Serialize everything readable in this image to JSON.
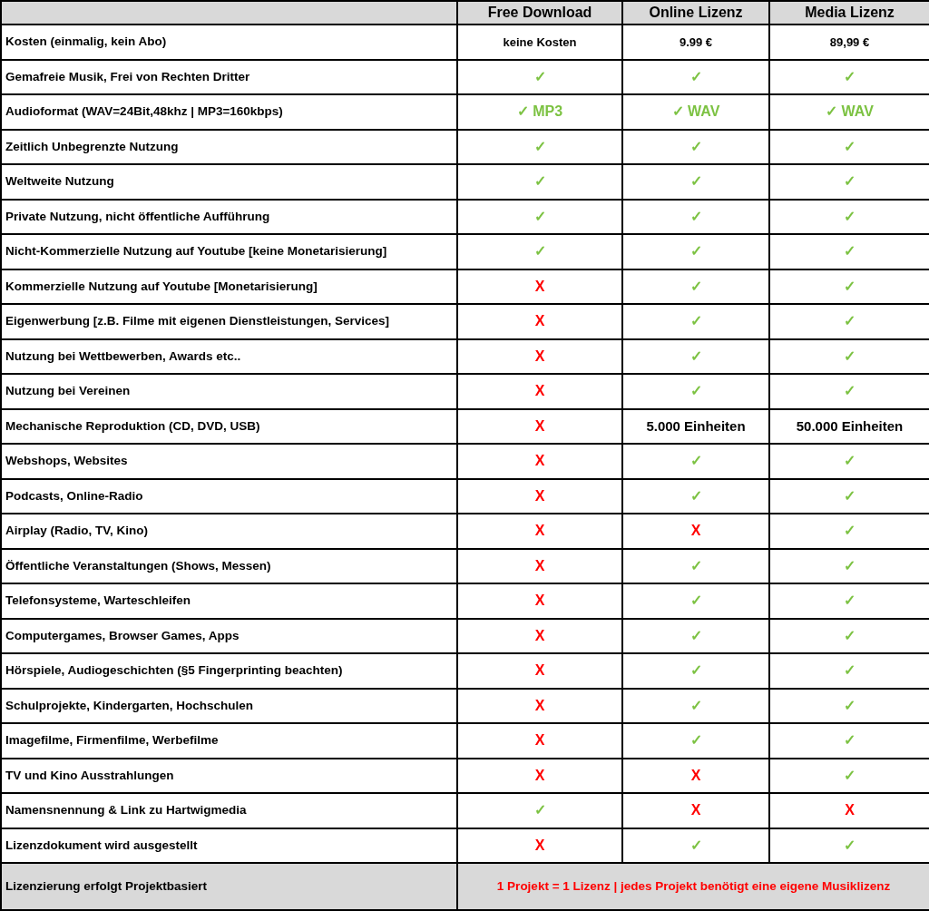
{
  "table": {
    "columns": [
      "Free Download",
      "Online Lizenz",
      "Media Lizenz"
    ],
    "rows": [
      {
        "label": "Kosten (einmalig, kein Abo)",
        "cells": [
          {
            "kind": "text",
            "text": "keine Kosten"
          },
          {
            "kind": "text",
            "text": "9.99 €"
          },
          {
            "kind": "text",
            "text": "89,99 €"
          }
        ]
      },
      {
        "label": "Gemafreie Musik, Frei von Rechten Dritter",
        "cells": [
          {
            "kind": "yes",
            "text": "✓"
          },
          {
            "kind": "yes",
            "text": "✓"
          },
          {
            "kind": "yes",
            "text": "✓"
          }
        ]
      },
      {
        "label": "Audioformat (WAV=24Bit,48khz | MP3=160kbps)",
        "cells": [
          {
            "kind": "yes",
            "text": "✓ MP3"
          },
          {
            "kind": "yes",
            "text": "✓ WAV"
          },
          {
            "kind": "yes",
            "text": "✓ WAV"
          }
        ]
      },
      {
        "label": "Zeitlich Unbegrenzte Nutzung",
        "cells": [
          {
            "kind": "yes",
            "text": "✓"
          },
          {
            "kind": "yes",
            "text": "✓"
          },
          {
            "kind": "yes",
            "text": "✓"
          }
        ]
      },
      {
        "label": "Weltweite Nutzung",
        "cells": [
          {
            "kind": "yes",
            "text": "✓"
          },
          {
            "kind": "yes",
            "text": "✓"
          },
          {
            "kind": "yes",
            "text": "✓"
          }
        ]
      },
      {
        "label": "Private Nutzung, nicht öffentliche Aufführung",
        "cells": [
          {
            "kind": "yes",
            "text": "✓"
          },
          {
            "kind": "yes",
            "text": "✓"
          },
          {
            "kind": "yes",
            "text": "✓"
          }
        ]
      },
      {
        "label": "Nicht-Kommerzielle Nutzung auf Youtube [keine Monetarisierung]",
        "cells": [
          {
            "kind": "yes",
            "text": "✓"
          },
          {
            "kind": "yes",
            "text": "✓"
          },
          {
            "kind": "yes",
            "text": "✓"
          }
        ]
      },
      {
        "label": "Kommerzielle Nutzung auf Youtube [Monetarisierung]",
        "cells": [
          {
            "kind": "no",
            "text": "X"
          },
          {
            "kind": "yes",
            "text": "✓"
          },
          {
            "kind": "yes",
            "text": "✓"
          }
        ]
      },
      {
        "label": "Eigenwerbung [z.B. Filme mit eigenen Dienstleistungen, Services]",
        "cells": [
          {
            "kind": "no",
            "text": "X"
          },
          {
            "kind": "yes",
            "text": "✓"
          },
          {
            "kind": "yes",
            "text": "✓"
          }
        ]
      },
      {
        "label": "Nutzung bei Wettbewerben, Awards etc..",
        "cells": [
          {
            "kind": "no",
            "text": "X"
          },
          {
            "kind": "yes",
            "text": "✓"
          },
          {
            "kind": "yes",
            "text": "✓"
          }
        ]
      },
      {
        "label": "Nutzung bei Vereinen",
        "cells": [
          {
            "kind": "no",
            "text": "X"
          },
          {
            "kind": "yes",
            "text": "✓"
          },
          {
            "kind": "yes",
            "text": "✓"
          }
        ]
      },
      {
        "label": "Mechanische Reproduktion (CD, DVD, USB)",
        "cells": [
          {
            "kind": "no",
            "text": "X"
          },
          {
            "kind": "big",
            "text": "5.000 Einheiten"
          },
          {
            "kind": "big",
            "text": "50.000 Einheiten"
          }
        ]
      },
      {
        "label": "Webshops, Websites",
        "cells": [
          {
            "kind": "no",
            "text": "X"
          },
          {
            "kind": "yes",
            "text": "✓"
          },
          {
            "kind": "yes",
            "text": "✓"
          }
        ]
      },
      {
        "label": "Podcasts, Online-Radio",
        "cells": [
          {
            "kind": "no",
            "text": "X"
          },
          {
            "kind": "yes",
            "text": "✓"
          },
          {
            "kind": "yes",
            "text": "✓"
          }
        ]
      },
      {
        "label": "Airplay (Radio, TV, Kino)",
        "cells": [
          {
            "kind": "no",
            "text": "X"
          },
          {
            "kind": "no",
            "text": "X"
          },
          {
            "kind": "yes",
            "text": "✓"
          }
        ]
      },
      {
        "label": "Öffentliche Veranstaltungen (Shows, Messen)",
        "cells": [
          {
            "kind": "no",
            "text": "X"
          },
          {
            "kind": "yes",
            "text": "✓"
          },
          {
            "kind": "yes",
            "text": "✓"
          }
        ]
      },
      {
        "label": "Telefonsysteme, Warteschleifen",
        "cells": [
          {
            "kind": "no",
            "text": "X"
          },
          {
            "kind": "yes",
            "text": "✓"
          },
          {
            "kind": "yes",
            "text": "✓"
          }
        ]
      },
      {
        "label": "Computergames, Browser Games, Apps",
        "cells": [
          {
            "kind": "no",
            "text": "X"
          },
          {
            "kind": "yes",
            "text": "✓"
          },
          {
            "kind": "yes",
            "text": "✓"
          }
        ]
      },
      {
        "label": "Hörspiele, Audiogeschichten (§5 Fingerprinting beachten)",
        "cells": [
          {
            "kind": "no",
            "text": "X"
          },
          {
            "kind": "yes",
            "text": "✓"
          },
          {
            "kind": "yes",
            "text": "✓"
          }
        ]
      },
      {
        "label": "Schulprojekte, Kindergarten, Hochschulen",
        "cells": [
          {
            "kind": "no",
            "text": "X"
          },
          {
            "kind": "yes",
            "text": "✓"
          },
          {
            "kind": "yes",
            "text": "✓"
          }
        ]
      },
      {
        "label": "Imagefilme, Firmenfilme, Werbefilme",
        "cells": [
          {
            "kind": "no",
            "text": "X"
          },
          {
            "kind": "yes",
            "text": "✓"
          },
          {
            "kind": "yes",
            "text": "✓"
          }
        ]
      },
      {
        "label": "TV und Kino Ausstrahlungen",
        "cells": [
          {
            "kind": "no",
            "text": "X"
          },
          {
            "kind": "no",
            "text": "X"
          },
          {
            "kind": "yes",
            "text": "✓"
          }
        ]
      },
      {
        "label": "Namensnennung & Link zu Hartwigmedia",
        "cells": [
          {
            "kind": "yes",
            "text": "✓"
          },
          {
            "kind": "no",
            "text": "X"
          },
          {
            "kind": "no",
            "text": "X"
          }
        ]
      },
      {
        "label": "Lizenzdokument wird ausgestellt",
        "cells": [
          {
            "kind": "no",
            "text": "X"
          },
          {
            "kind": "yes",
            "text": "✓"
          },
          {
            "kind": "yes",
            "text": "✓"
          }
        ]
      }
    ],
    "footer": {
      "label": "Lizenzierung erfolgt Projektbasiert",
      "note": "1 Projekt = 1 Lizenz | jedes Projekt benötigt eine eigene Musiklizenz"
    }
  }
}
